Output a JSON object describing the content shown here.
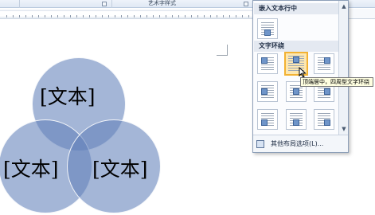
{
  "ribbon": {
    "group_label": "艺术字样式"
  },
  "venn": {
    "labels": [
      "[文本]",
      "[文本]",
      "[文本]"
    ],
    "fill_color": "#6382ba"
  },
  "gallery": {
    "section_inline": "嵌入文本行中",
    "section_wrap": "文字环绕",
    "scroll_up": "▲",
    "scroll_down": "▼",
    "footer_label": "其他布局选项(L)...",
    "selected_color": "#f2b233"
  },
  "tooltip": {
    "text": "顶端居中，四周型文字环绕"
  }
}
